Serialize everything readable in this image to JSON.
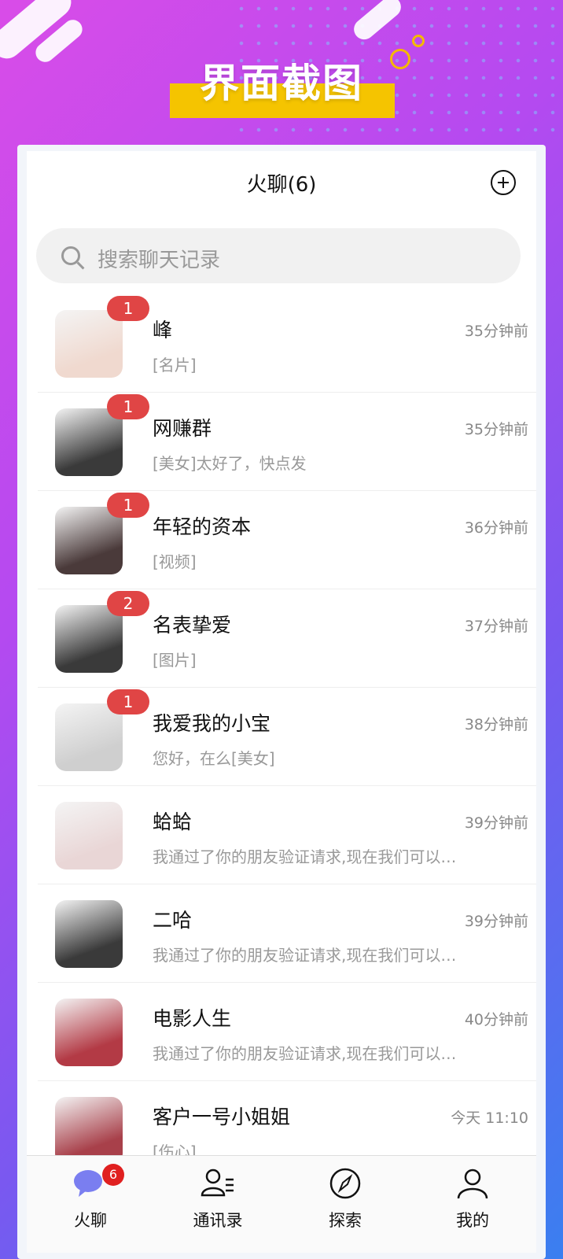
{
  "banner": {
    "title": "界面截图"
  },
  "header": {
    "title": "火聊(6)"
  },
  "search": {
    "placeholder": "搜索聊天记录"
  },
  "chats": [
    {
      "name": "峰",
      "preview": "[名片]",
      "time": "35分钟前",
      "badge": "1",
      "avatar_color": "#f0d9cf"
    },
    {
      "name": "网赚群",
      "preview": "[美女]太好了，快点发",
      "time": "35分钟前",
      "badge": "1",
      "avatar_color": "#3a3a3a"
    },
    {
      "name": "年轻的资本",
      "preview": "[视频]",
      "time": "36分钟前",
      "badge": "1",
      "avatar_color": "#4a3a3a"
    },
    {
      "name": "名表挚爱",
      "preview": "[图片]",
      "time": "37分钟前",
      "badge": "2",
      "avatar_color": "#3a3a3a"
    },
    {
      "name": "我爱我的小宝",
      "preview": "您好，在么[美女]",
      "time": "38分钟前",
      "badge": "1",
      "avatar_color": "#cfcfcf"
    },
    {
      "name": "蛤蛤",
      "preview": "我通过了你的朋友验证请求,现在我们可以…",
      "time": "39分钟前",
      "badge": "",
      "avatar_color": "#e9d6d6"
    },
    {
      "name": "二哈",
      "preview": "我通过了你的朋友验证请求,现在我们可以…",
      "time": "39分钟前",
      "badge": "",
      "avatar_color": "#3a3a3a"
    },
    {
      "name": "电影人生",
      "preview": "我通过了你的朋友验证请求,现在我们可以…",
      "time": "40分钟前",
      "badge": "",
      "avatar_color": "#b33a45"
    },
    {
      "name": "客户一号小姐姐",
      "preview": "[伤心]",
      "time": "今天 11:10",
      "badge": "",
      "avatar_color": "#a8404a"
    }
  ],
  "tabbar": {
    "items": [
      {
        "label": "火聊",
        "icon": "chat-bubble-icon",
        "badge": "6"
      },
      {
        "label": "通讯录",
        "icon": "contacts-icon",
        "badge": ""
      },
      {
        "label": "探索",
        "icon": "compass-icon",
        "badge": ""
      },
      {
        "label": "我的",
        "icon": "profile-icon",
        "badge": ""
      }
    ]
  },
  "colors": {
    "accent": "#e04545",
    "tab_badge": "#e02020",
    "chat_icon": "#7a7ef0",
    "banner_bar": "#f5c400"
  }
}
